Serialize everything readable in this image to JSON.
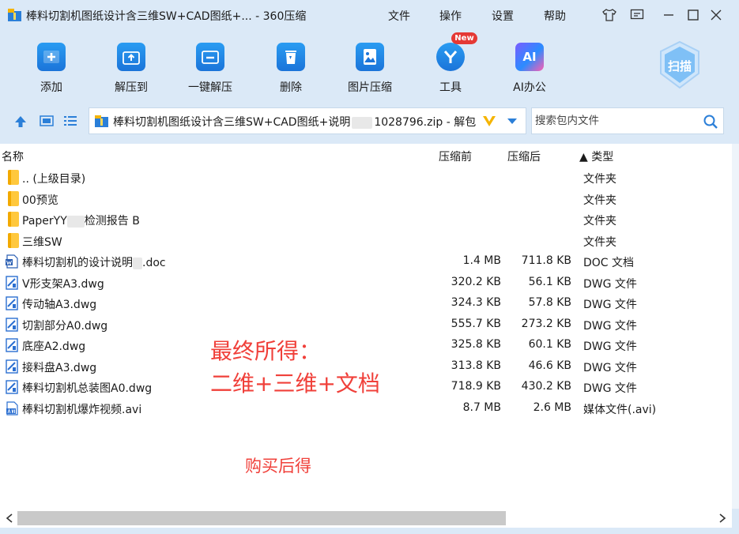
{
  "window": {
    "title": "棒料切割机图纸设计含三维SW+CAD图纸+... - 360压缩",
    "menu": [
      "文件",
      "操作",
      "设置",
      "帮助"
    ]
  },
  "toolbar": {
    "buttons": [
      {
        "label": "添加",
        "icon": "add-icon"
      },
      {
        "label": "解压到",
        "icon": "extract-icon"
      },
      {
        "label": "一键解压",
        "icon": "one-click-extract-icon"
      },
      {
        "label": "删除",
        "icon": "delete-icon"
      },
      {
        "label": "图片压缩",
        "icon": "image-compress-icon"
      },
      {
        "label": "工具",
        "icon": "tools-icon"
      },
      {
        "label": "AI办公",
        "icon": "ai-office-icon"
      }
    ],
    "new_badge": "New",
    "scan_label": "扫描",
    "ai_icon_text": "AI"
  },
  "address": {
    "path_prefix": "棒料切割机图纸设计含三维SW+CAD图纸+说明",
    "path_suffix": "1028796.zip - 解包"
  },
  "search": {
    "placeholder": "搜索包内文件"
  },
  "columns": {
    "name": "名称",
    "size_before": "压缩前",
    "size_after": "压缩后",
    "type": "▲ 类型"
  },
  "files": [
    {
      "name": ".. (上级目录)",
      "size_before": "",
      "size_after": "",
      "type": "文件夹",
      "icon": "folder-icon"
    },
    {
      "name": "00预览",
      "size_before": "",
      "size_after": "",
      "type": "文件夹",
      "icon": "folder-icon"
    },
    {
      "name_a": "PaperYY",
      "name_b": "检测报告 B",
      "size_before": "",
      "size_after": "",
      "type": "文件夹",
      "icon": "folder-icon"
    },
    {
      "name": "三维SW",
      "size_before": "",
      "size_after": "",
      "type": "文件夹",
      "icon": "folder-icon"
    },
    {
      "name_a": "棒料切割机的设计说明",
      "name_b": ".doc",
      "size_before": "1.4 MB",
      "size_after": "711.8 KB",
      "type": "DOC 文档",
      "icon": "word-doc-icon"
    },
    {
      "name": "V形支架A3.dwg",
      "size_before": "320.2 KB",
      "size_after": "56.1 KB",
      "type": "DWG 文件",
      "icon": "dwg-file-icon"
    },
    {
      "name": "传动轴A3.dwg",
      "size_before": "324.3 KB",
      "size_after": "57.8 KB",
      "type": "DWG 文件",
      "icon": "dwg-file-icon"
    },
    {
      "name": "切割部分A0.dwg",
      "size_before": "555.7 KB",
      "size_after": "273.2 KB",
      "type": "DWG 文件",
      "icon": "dwg-file-icon"
    },
    {
      "name": "底座A2.dwg",
      "size_before": "325.8 KB",
      "size_after": "60.1 KB",
      "type": "DWG 文件",
      "icon": "dwg-file-icon"
    },
    {
      "name": "接料盘A3.dwg",
      "size_before": "313.8 KB",
      "size_after": "46.6 KB",
      "type": "DWG 文件",
      "icon": "dwg-file-icon"
    },
    {
      "name": "棒料切割机总装图A0.dwg",
      "size_before": "718.9 KB",
      "size_after": "430.2 KB",
      "type": "DWG 文件",
      "icon": "dwg-file-icon"
    },
    {
      "name": "棒料切割机爆炸视频.avi",
      "size_before": "8.7 MB",
      "size_after": "2.6 MB",
      "type": "媒体文件(.avi)",
      "icon": "avi-file-icon"
    }
  ],
  "overlay": {
    "line1": "最终所得：",
    "line2": "二维+三维+文档",
    "line3": "购买后得"
  },
  "colors": {
    "accent": "#1b74d9",
    "overlay_text": "#f0403a",
    "background": "#dbe9f7"
  }
}
